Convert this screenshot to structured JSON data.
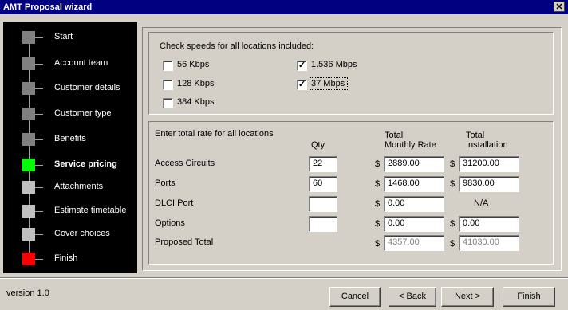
{
  "window": {
    "title": "AMT Proposal  wizard",
    "close_glyph": "✕"
  },
  "sidebar": {
    "steps": [
      {
        "label": "Start",
        "state": "done"
      },
      {
        "label": "Account team",
        "state": "done"
      },
      {
        "label": "Customer details",
        "state": "done"
      },
      {
        "label": "Customer type",
        "state": "done"
      },
      {
        "label": "Benefits",
        "state": "done"
      },
      {
        "label": "Service pricing",
        "state": "current"
      },
      {
        "label": "Attachments",
        "state": "future"
      },
      {
        "label": "Estimate timetable",
        "state": "future"
      },
      {
        "label": "Cover choices",
        "state": "future"
      },
      {
        "label": "Finish",
        "state": "finish"
      }
    ],
    "colors": {
      "done": "#808080",
      "current": "#00ff00",
      "future": "#c0c0c0",
      "finish": "#ff0000"
    }
  },
  "speeds": {
    "heading": "Check speeds for all locations included:",
    "options": [
      {
        "label": "56 Kbps",
        "checked": false
      },
      {
        "label": "128 Kbps",
        "checked": false
      },
      {
        "label": "384 Kbps",
        "checked": false
      },
      {
        "label": "1.536 Mbps",
        "checked": true
      },
      {
        "label": "37 Mbps",
        "checked": true
      }
    ],
    "check_glyph": "✓"
  },
  "rates": {
    "heading": "Enter total rate for all locations",
    "col_qty": "Qty",
    "col_monthly_1": "Total",
    "col_monthly_2": "Monthly Rate",
    "col_install_1": "Total",
    "col_install_2": "Installation",
    "currency": "$",
    "rows": [
      {
        "label": "Access Circuits",
        "qty": "22",
        "monthly": "2889.00",
        "install": "31200.00"
      },
      {
        "label": "Ports",
        "qty": "60",
        "monthly": "1468.00",
        "install": "9830.00"
      },
      {
        "label": "DLCI Port",
        "qty": "",
        "monthly": "0.00",
        "install": "N/A"
      },
      {
        "label": "Options",
        "qty": "",
        "monthly": "0.00",
        "install": "0.00"
      }
    ],
    "total": {
      "label": "Proposed Total",
      "monthly": "4357.00",
      "install": "41030.00"
    }
  },
  "footer": {
    "version": "version 1.0",
    "cancel": "Cancel",
    "back": "< Back",
    "next": "Next >",
    "finish": "Finish"
  }
}
